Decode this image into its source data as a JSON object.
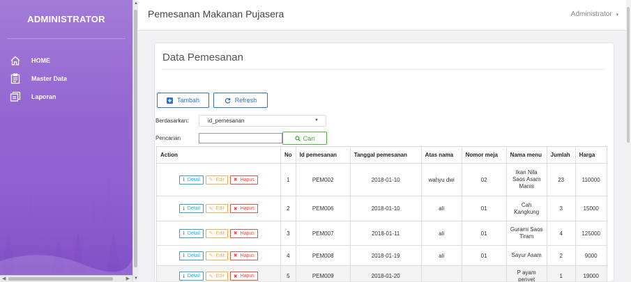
{
  "sidebar": {
    "brand": "ADMINISTRATOR",
    "items": [
      {
        "label": "HOME",
        "icon": "home-icon"
      },
      {
        "label": "Master Data",
        "icon": "clipboard-icon"
      },
      {
        "label": "Laporan",
        "icon": "report-icon"
      }
    ]
  },
  "header": {
    "title": "Pemesanan Makanan Pujasera",
    "user": "Administrator"
  },
  "panel": {
    "title": "Data Pemesanan",
    "add_label": "Tambah",
    "refresh_label": "Refresh",
    "filter_label": "Berdasarkan:",
    "filter_value": "id_pemesanan",
    "search_label": "Pencarian",
    "search_value": "",
    "search_button": "Cari"
  },
  "table": {
    "headers": [
      "Action",
      "No",
      "Id pemesanan",
      "Tanggal pemesanan",
      "Atas nama",
      "Nomor meja",
      "Nama menu",
      "Jumlah",
      "Harga"
    ],
    "action_labels": {
      "detail": "Detail",
      "edit": "Edit",
      "hapus": "Hapus"
    },
    "rows": [
      {
        "no": "1",
        "id": "PEM002",
        "tanggal": "2018-01-10",
        "atas_nama": "wahyu dwi",
        "meja": "02",
        "menu": "Ikan Nila Saos Asam Manis",
        "jumlah": "23",
        "harga": "110000"
      },
      {
        "no": "2",
        "id": "PEM006",
        "tanggal": "2018-01-10",
        "atas_nama": "ali",
        "meja": "01",
        "menu": "Cah Kangkung",
        "jumlah": "3",
        "harga": "15000"
      },
      {
        "no": "3",
        "id": "PEM007",
        "tanggal": "2018-01-11",
        "atas_nama": "ali",
        "meja": "01",
        "menu": "Gurami Saos Tiram",
        "jumlah": "4",
        "harga": "125000"
      },
      {
        "no": "4",
        "id": "PEM008",
        "tanggal": "2018-01-19",
        "atas_nama": "ali",
        "meja": "01",
        "menu": "Sayur Asam",
        "jumlah": "2",
        "harga": "9000"
      },
      {
        "no": "5",
        "id": "PEM009",
        "tanggal": "2018-01-20",
        "atas_nama": "",
        "meja": "",
        "menu": "P ayam penyet",
        "jumlah": "1",
        "harga": "19000"
      }
    ]
  },
  "colors": {
    "sidebar": "#9566d2",
    "primary": "#2f6fd0",
    "success": "#57b24a",
    "info": "#29a5d6",
    "warning": "#f0ad4e",
    "danger": "#d9534f"
  }
}
